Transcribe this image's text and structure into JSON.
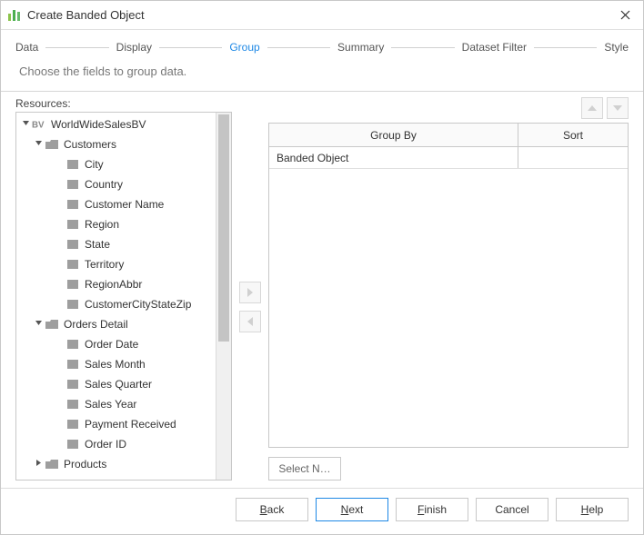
{
  "window": {
    "title": "Create Banded Object"
  },
  "steps": {
    "items": [
      {
        "label": "Data",
        "active": false
      },
      {
        "label": "Display",
        "active": false
      },
      {
        "label": "Group",
        "active": true
      },
      {
        "label": "Summary",
        "active": false
      },
      {
        "label": "Dataset Filter",
        "active": false
      },
      {
        "label": "Style",
        "active": false
      }
    ]
  },
  "description": "Choose the fields to group data.",
  "resources": {
    "label": "Resources:",
    "tree": [
      {
        "label": "WorldWideSalesBV",
        "depth": 0,
        "expand": "open",
        "icon": "bv"
      },
      {
        "label": "Customers",
        "depth": 1,
        "expand": "open",
        "icon": "folder"
      },
      {
        "label": "City",
        "depth": 2,
        "icon": "field"
      },
      {
        "label": "Country",
        "depth": 2,
        "icon": "field"
      },
      {
        "label": "Customer Name",
        "depth": 2,
        "icon": "field"
      },
      {
        "label": "Region",
        "depth": 2,
        "icon": "field"
      },
      {
        "label": "State",
        "depth": 2,
        "icon": "field"
      },
      {
        "label": "Territory",
        "depth": 2,
        "icon": "field"
      },
      {
        "label": "RegionAbbr",
        "depth": 2,
        "icon": "field"
      },
      {
        "label": "CustomerCityStateZip",
        "depth": 2,
        "icon": "field"
      },
      {
        "label": "Orders Detail",
        "depth": 1,
        "expand": "open",
        "icon": "folder"
      },
      {
        "label": "Order Date",
        "depth": 2,
        "icon": "field"
      },
      {
        "label": "Sales Month",
        "depth": 2,
        "icon": "field"
      },
      {
        "label": "Sales Quarter",
        "depth": 2,
        "icon": "field"
      },
      {
        "label": "Sales Year",
        "depth": 2,
        "icon": "field"
      },
      {
        "label": "Payment Received",
        "depth": 2,
        "icon": "field"
      },
      {
        "label": "Order ID",
        "depth": 2,
        "icon": "field"
      },
      {
        "label": "Products",
        "depth": 1,
        "expand": "closed",
        "icon": "folder"
      }
    ]
  },
  "group_table": {
    "headers": {
      "groupby": "Group By",
      "sort": "Sort"
    },
    "rows": [
      {
        "groupby": "Banded Object",
        "sort": ""
      }
    ]
  },
  "select_button": "Select N…",
  "footer": {
    "back": "Back",
    "next": "Next",
    "finish": "Finish",
    "cancel": "Cancel",
    "help": "Help"
  }
}
